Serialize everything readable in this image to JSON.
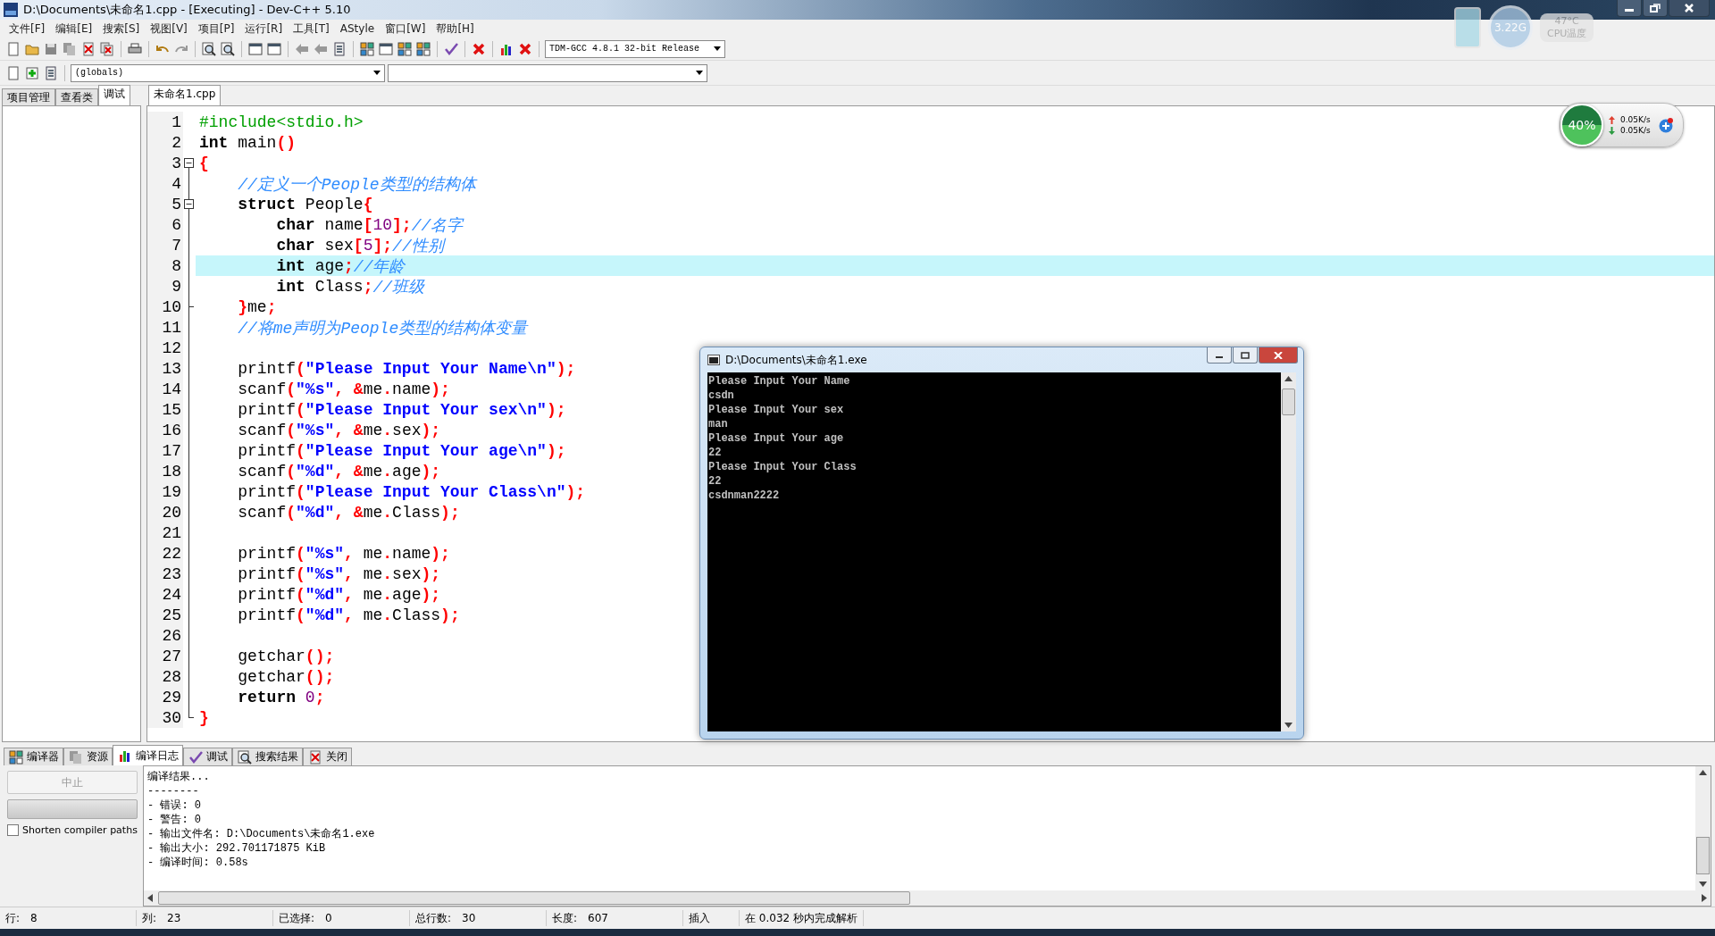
{
  "window": {
    "title": "D:\\Documents\\未命名1.cpp - [Executing] - Dev-C++ 5.10"
  },
  "menu": [
    "文件[F]",
    "编辑[E]",
    "搜索[S]",
    "视图[V]",
    "项目[P]",
    "运行[R]",
    "工具[T]",
    "AStyle",
    "窗口[W]",
    "帮助[H]"
  ],
  "compiler_select": {
    "value": "TDM-GCC 4.8.1 32-bit Release"
  },
  "scope_select": {
    "value": "(globals)"
  },
  "side_tabs": [
    {
      "label": "项目管理",
      "selected": false
    },
    {
      "label": "查看类",
      "selected": false
    },
    {
      "label": "调试",
      "selected": true
    }
  ],
  "editor_tabs": [
    {
      "label": "未命名1.cpp",
      "selected": true
    }
  ],
  "code": [
    {
      "number": "1",
      "tokens": [
        {
          "text": "#include<stdio.h>",
          "kind": "pre"
        }
      ],
      "selected": false
    },
    {
      "number": "2",
      "tokens": [
        {
          "text": "int",
          "kind": "kw"
        },
        {
          "text": " main",
          "kind": "id"
        },
        {
          "text": "()",
          "kind": "sym"
        }
      ],
      "selected": false
    },
    {
      "number": "3",
      "fold_start": true,
      "tokens": [
        {
          "text": "{",
          "kind": "sym"
        }
      ],
      "selected": false
    },
    {
      "number": "4",
      "tokens": [
        {
          "text": "    //定义一个People类型的结构体",
          "kind": "cmt"
        }
      ],
      "selected": false
    },
    {
      "number": "5",
      "fold_start": true,
      "tokens": [
        {
          "text": "    struct",
          "kind": "kw"
        },
        {
          "text": " People",
          "kind": "id"
        },
        {
          "text": "{",
          "kind": "sym"
        }
      ],
      "selected": false
    },
    {
      "number": "6",
      "tokens": [
        {
          "text": "        char",
          "kind": "kw"
        },
        {
          "text": " name",
          "kind": "id"
        },
        {
          "text": "[",
          "kind": "sym"
        },
        {
          "text": "10",
          "kind": "num"
        },
        {
          "text": "];",
          "kind": "sym"
        },
        {
          "text": "//名字",
          "kind": "cmt"
        }
      ],
      "selected": false
    },
    {
      "number": "7",
      "tokens": [
        {
          "text": "        char",
          "kind": "kw"
        },
        {
          "text": " sex",
          "kind": "id"
        },
        {
          "text": "[",
          "kind": "sym"
        },
        {
          "text": "5",
          "kind": "num"
        },
        {
          "text": "];",
          "kind": "sym"
        },
        {
          "text": "//性别",
          "kind": "cmt"
        }
      ],
      "selected": false
    },
    {
      "number": "8",
      "tokens": [
        {
          "text": "        int",
          "kind": "kw"
        },
        {
          "text": " age",
          "kind": "id"
        },
        {
          "text": ";",
          "kind": "sym"
        },
        {
          "text": "//年龄",
          "kind": "cmt"
        }
      ],
      "selected": true
    },
    {
      "number": "9",
      "tokens": [
        {
          "text": "        int",
          "kind": "kw"
        },
        {
          "text": " Class",
          "kind": "id"
        },
        {
          "text": ";",
          "kind": "sym"
        },
        {
          "text": "//班级",
          "kind": "cmt"
        }
      ],
      "selected": false
    },
    {
      "number": "10",
      "fold_end": true,
      "tokens": [
        {
          "text": "    }",
          "kind": "sym"
        },
        {
          "text": "me",
          "kind": "id"
        },
        {
          "text": ";",
          "kind": "sym"
        }
      ],
      "selected": false
    },
    {
      "number": "11",
      "tokens": [
        {
          "text": "    //将me声明为People类型的结构体变量",
          "kind": "cmt"
        }
      ],
      "selected": false
    },
    {
      "number": "12",
      "selected": false
    },
    {
      "number": "13",
      "tokens": [
        {
          "text": "    printf",
          "kind": "id"
        },
        {
          "text": "(",
          "kind": "sym"
        },
        {
          "text": "\"Please Input Your Name\\n\"",
          "kind": "str"
        },
        {
          "text": ");",
          "kind": "sym"
        }
      ],
      "selected": false
    },
    {
      "number": "14",
      "tokens": [
        {
          "text": "    scanf",
          "kind": "id"
        },
        {
          "text": "(",
          "kind": "sym"
        },
        {
          "text": "\"%s\"",
          "kind": "str"
        },
        {
          "text": ", &",
          "kind": "sym"
        },
        {
          "text": "me",
          "kind": "id"
        },
        {
          "text": ".",
          "kind": "sym"
        },
        {
          "text": "name",
          "kind": "id"
        },
        {
          "text": ");",
          "kind": "sym"
        }
      ],
      "selected": false
    },
    {
      "number": "15",
      "tokens": [
        {
          "text": "    printf",
          "kind": "id"
        },
        {
          "text": "(",
          "kind": "sym"
        },
        {
          "text": "\"Please Input Your sex\\n\"",
          "kind": "str"
        },
        {
          "text": ");",
          "kind": "sym"
        }
      ],
      "selected": false
    },
    {
      "number": "16",
      "tokens": [
        {
          "text": "    scanf",
          "kind": "id"
        },
        {
          "text": "(",
          "kind": "sym"
        },
        {
          "text": "\"%s\"",
          "kind": "str"
        },
        {
          "text": ", &",
          "kind": "sym"
        },
        {
          "text": "me",
          "kind": "id"
        },
        {
          "text": ".",
          "kind": "sym"
        },
        {
          "text": "sex",
          "kind": "id"
        },
        {
          "text": ");",
          "kind": "sym"
        }
      ],
      "selected": false
    },
    {
      "number": "17",
      "tokens": [
        {
          "text": "    printf",
          "kind": "id"
        },
        {
          "text": "(",
          "kind": "sym"
        },
        {
          "text": "\"Please Input Your age\\n\"",
          "kind": "str"
        },
        {
          "text": ");",
          "kind": "sym"
        }
      ],
      "selected": false
    },
    {
      "number": "18",
      "tokens": [
        {
          "text": "    scanf",
          "kind": "id"
        },
        {
          "text": "(",
          "kind": "sym"
        },
        {
          "text": "\"%d\"",
          "kind": "str"
        },
        {
          "text": ", &",
          "kind": "sym"
        },
        {
          "text": "me",
          "kind": "id"
        },
        {
          "text": ".",
          "kind": "sym"
        },
        {
          "text": "age",
          "kind": "id"
        },
        {
          "text": ");",
          "kind": "sym"
        }
      ],
      "selected": false
    },
    {
      "number": "19",
      "tokens": [
        {
          "text": "    printf",
          "kind": "id"
        },
        {
          "text": "(",
          "kind": "sym"
        },
        {
          "text": "\"Please Input Your Class\\n\"",
          "kind": "str"
        },
        {
          "text": ");",
          "kind": "sym"
        }
      ],
      "selected": false
    },
    {
      "number": "20",
      "tokens": [
        {
          "text": "    scanf",
          "kind": "id"
        },
        {
          "text": "(",
          "kind": "sym"
        },
        {
          "text": "\"%d\"",
          "kind": "str"
        },
        {
          "text": ", &",
          "kind": "sym"
        },
        {
          "text": "me",
          "kind": "id"
        },
        {
          "text": ".",
          "kind": "sym"
        },
        {
          "text": "Class",
          "kind": "id"
        },
        {
          "text": ");",
          "kind": "sym"
        }
      ],
      "selected": false
    },
    {
      "number": "21",
      "selected": false
    },
    {
      "number": "22",
      "tokens": [
        {
          "text": "    printf",
          "kind": "id"
        },
        {
          "text": "(",
          "kind": "sym"
        },
        {
          "text": "\"%s\"",
          "kind": "str"
        },
        {
          "text": ",",
          "kind": "sym"
        },
        {
          "text": " me",
          "kind": "id"
        },
        {
          "text": ".",
          "kind": "sym"
        },
        {
          "text": "name",
          "kind": "id"
        },
        {
          "text": ");",
          "kind": "sym"
        }
      ],
      "selected": false
    },
    {
      "number": "23",
      "tokens": [
        {
          "text": "    printf",
          "kind": "id"
        },
        {
          "text": "(",
          "kind": "sym"
        },
        {
          "text": "\"%s\"",
          "kind": "str"
        },
        {
          "text": ",",
          "kind": "sym"
        },
        {
          "text": " me",
          "kind": "id"
        },
        {
          "text": ".",
          "kind": "sym"
        },
        {
          "text": "sex",
          "kind": "id"
        },
        {
          "text": ");",
          "kind": "sym"
        }
      ],
      "selected": false
    },
    {
      "number": "24",
      "tokens": [
        {
          "text": "    printf",
          "kind": "id"
        },
        {
          "text": "(",
          "kind": "sym"
        },
        {
          "text": "\"%d\"",
          "kind": "str"
        },
        {
          "text": ",",
          "kind": "sym"
        },
        {
          "text": " me",
          "kind": "id"
        },
        {
          "text": ".",
          "kind": "sym"
        },
        {
          "text": "age",
          "kind": "id"
        },
        {
          "text": ");",
          "kind": "sym"
        }
      ],
      "selected": false
    },
    {
      "number": "25",
      "tokens": [
        {
          "text": "    printf",
          "kind": "id"
        },
        {
          "text": "(",
          "kind": "sym"
        },
        {
          "text": "\"%d\"",
          "kind": "str"
        },
        {
          "text": ",",
          "kind": "sym"
        },
        {
          "text": " me",
          "kind": "id"
        },
        {
          "text": ".",
          "kind": "sym"
        },
        {
          "text": "Class",
          "kind": "id"
        },
        {
          "text": ");",
          "kind": "sym"
        }
      ],
      "selected": false
    },
    {
      "number": "26",
      "selected": false
    },
    {
      "number": "27",
      "tokens": [
        {
          "text": "    getchar",
          "kind": "id"
        },
        {
          "text": "();",
          "kind": "sym"
        }
      ],
      "selected": false
    },
    {
      "number": "28",
      "tokens": [
        {
          "text": "    getchar",
          "kind": "id"
        },
        {
          "text": "();",
          "kind": "sym"
        }
      ],
      "selected": false
    },
    {
      "number": "29",
      "tokens": [
        {
          "text": "    return ",
          "kind": "kw"
        },
        {
          "text": "0",
          "kind": "num"
        },
        {
          "text": ";",
          "kind": "sym"
        }
      ],
      "selected": false
    },
    {
      "number": "30",
      "fold_end": true,
      "tokens": [
        {
          "text": "}",
          "kind": "sym"
        }
      ],
      "selected": false
    }
  ],
  "console": {
    "title": "D:\\Documents\\未命名1.exe",
    "lines": [
      "Please Input Your Name",
      "csdn",
      "Please Input Your sex",
      "man",
      "Please Input Your age",
      "22",
      "Please Input Your Class",
      "22",
      "csdnman2222"
    ]
  },
  "desktop_widget": {
    "speed": "3.22G",
    "temperature": "47°C",
    "temperature_label": "CPU温度"
  },
  "network_widget": {
    "memory": "40%",
    "upload": "0.05K/s",
    "download": "0.05K/s"
  },
  "bottom_tabs": [
    {
      "label": "编译器",
      "selected": false
    },
    {
      "label": "资源",
      "selected": false
    },
    {
      "label": "编译日志",
      "selected": true
    },
    {
      "label": "调试",
      "selected": false
    },
    {
      "label": "搜索结果",
      "selected": false
    },
    {
      "label": "关闭",
      "selected": false
    }
  ],
  "abort_button": {
    "label": "中止",
    "disabled": true
  },
  "progress": {
    "level": 0
  },
  "shorten_paths": {
    "label": "Shorten compiler paths",
    "checked": false
  },
  "log": [
    "编译结果...",
    "--------",
    "- 错误: 0",
    "- 警告: 0",
    "- 输出文件名: D:\\Documents\\未命名1.exe",
    "- 输出大小: 292.701171875 KiB",
    "- 编译时间: 0.58s"
  ],
  "status_bar": [
    {
      "label": "行:",
      "value": "8"
    },
    {
      "label": "列:",
      "value": "23"
    },
    {
      "label": "已选择:",
      "value": "0"
    },
    {
      "label": "总行数:",
      "value": "30"
    },
    {
      "label": "长度:",
      "value": "607"
    },
    {
      "value": "插入"
    },
    {
      "value": "在 0.032 秒内完成解析"
    }
  ]
}
